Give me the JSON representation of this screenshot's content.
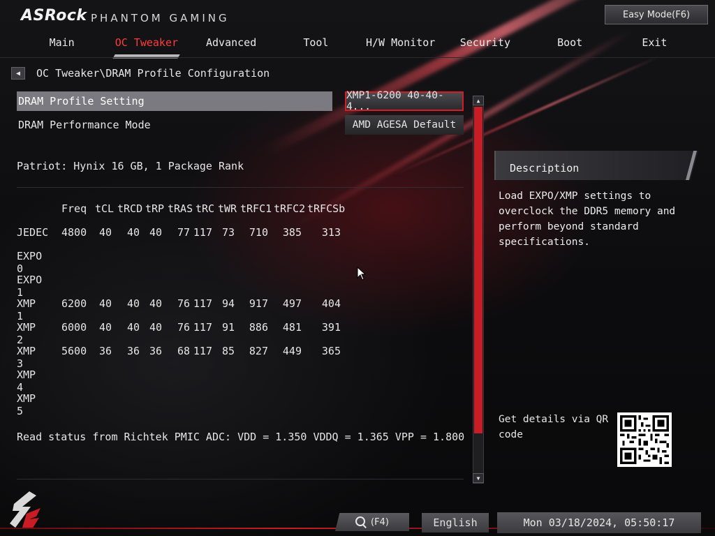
{
  "header": {
    "brand": "ASRock",
    "subbrand": "PHANTOM GAMING",
    "easy_mode_label": "Easy Mode(F6)"
  },
  "tabs": [
    {
      "label": "Main",
      "active": false
    },
    {
      "label": "OC Tweaker",
      "active": true
    },
    {
      "label": "Advanced",
      "active": false
    },
    {
      "label": "Tool",
      "active": false
    },
    {
      "label": "H/W Monitor",
      "active": false
    },
    {
      "label": "Security",
      "active": false
    },
    {
      "label": "Boot",
      "active": false
    },
    {
      "label": "Exit",
      "active": false
    }
  ],
  "breadcrumb": "OC Tweaker\\DRAM Profile Configuration",
  "settings": {
    "profile": {
      "label": "DRAM Profile Setting",
      "value": "XMP1-6200 40-40-4..."
    },
    "perf_mode": {
      "label": "DRAM Performance Mode",
      "value": "AMD AGESA Default"
    }
  },
  "memory_info": "Patriot: Hynix 16 GB, 1 Package Rank",
  "timing_table": {
    "headers": [
      "",
      "Freq",
      "tCL",
      "tRCD",
      "tRP",
      "tRAS",
      "tRC",
      "tWR",
      "tRFC1",
      "tRFC2",
      "tRFCSb"
    ],
    "rows": [
      [
        "JEDEC",
        "4800",
        "40",
        "40",
        "40",
        "77",
        "117",
        "73",
        "710",
        "385",
        "313"
      ],
      [
        "EXPO 0",
        "",
        "",
        "",
        "",
        "",
        "",
        "",
        "",
        "",
        ""
      ],
      [
        "EXPO 1",
        "",
        "",
        "",
        "",
        "",
        "",
        "",
        "",
        "",
        ""
      ],
      [
        "XMP 1",
        "6200",
        "40",
        "40",
        "40",
        "76",
        "117",
        "94",
        "917",
        "497",
        "404"
      ],
      [
        "XMP 2",
        "6000",
        "40",
        "40",
        "40",
        "76",
        "117",
        "91",
        "886",
        "481",
        "391"
      ],
      [
        "XMP 3",
        "5600",
        "36",
        "36",
        "36",
        "68",
        "117",
        "85",
        "827",
        "449",
        "365"
      ],
      [
        "XMP 4",
        "",
        "",
        "",
        "",
        "",
        "",
        "",
        "",
        "",
        ""
      ],
      [
        "XMP 5",
        "",
        "",
        "",
        "",
        "",
        "",
        "",
        "",
        "",
        ""
      ]
    ]
  },
  "pmic_status": "Read status from Richtek PMIC ADC: VDD = 1.350 VDDQ = 1.365 VPP = 1.800",
  "description": {
    "title": "Description",
    "text": "Load EXPO/XMP settings to\noverclock the DDR5 memory and\nperform beyond standard\nspecifications.",
    "qr_label": "Get details via QR\ncode"
  },
  "footer": {
    "search_key": "(F4)",
    "language": "English",
    "datetime": "Mon 03/18/2024, 05:50:17"
  },
  "colors": {
    "accent": "#c81d24",
    "active_tab": "#ff3b3b",
    "selected_row": "#7a7a80"
  },
  "icons": [
    "back-arrow-icon",
    "search-icon",
    "scroll-up-icon",
    "scroll-down-icon",
    "qr-code-icon",
    "mouse-cursor-icon"
  ]
}
